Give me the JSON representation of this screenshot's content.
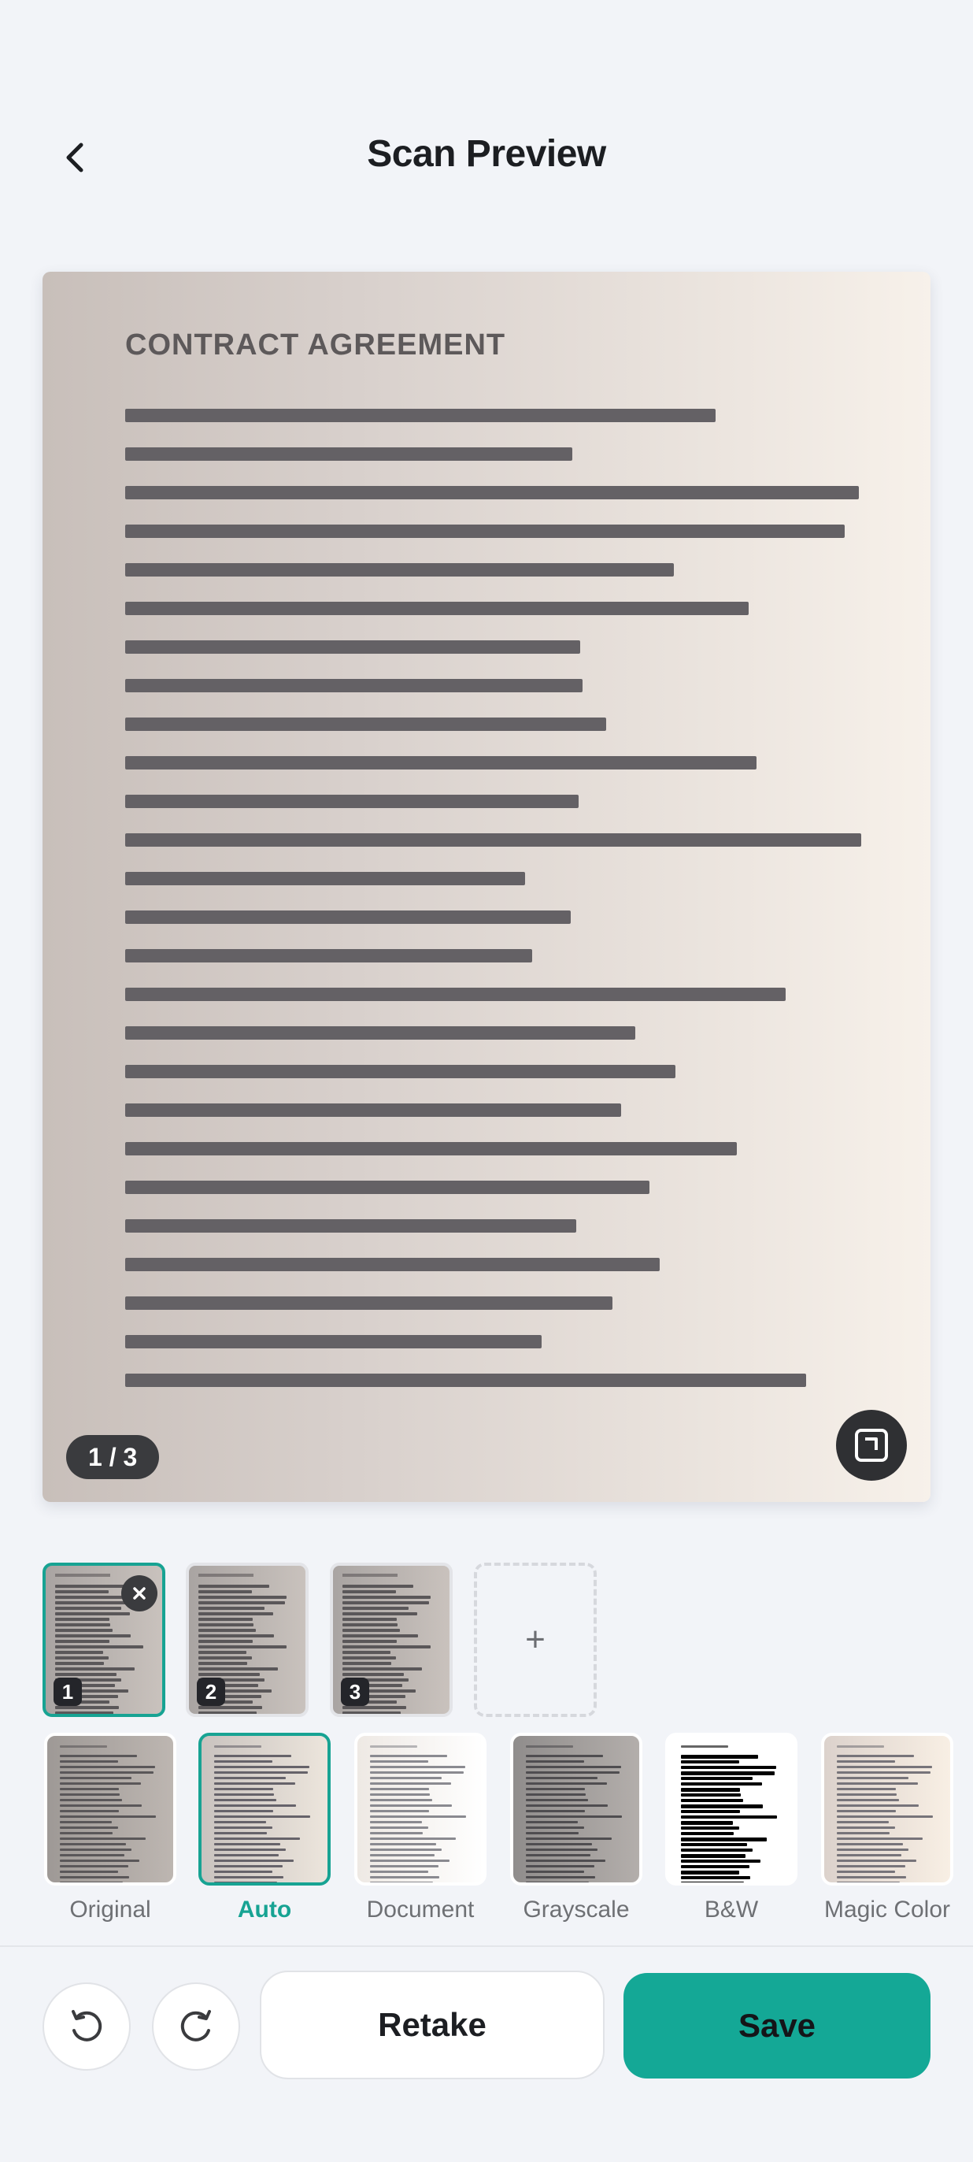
{
  "header": {
    "title": "Scan Preview",
    "back_icon": "chevron-left-icon"
  },
  "preview": {
    "document_title": "CONTRACT AGREEMENT",
    "page_indicator": "1 / 3",
    "crop_icon": "crop-frame-icon"
  },
  "pages": [
    {
      "number": "1",
      "selected": true,
      "removable": true
    },
    {
      "number": "2",
      "selected": false
    },
    {
      "number": "3",
      "selected": false
    }
  ],
  "add_page": {
    "label": "+"
  },
  "filters": [
    {
      "label": "Original",
      "selected": false
    },
    {
      "label": "Auto",
      "selected": true
    },
    {
      "label": "Document",
      "selected": false
    },
    {
      "label": "Grayscale",
      "selected": false
    },
    {
      "label": "B&W",
      "selected": false
    },
    {
      "label": "Magic Color",
      "selected": false
    }
  ],
  "actions": {
    "undo_icon": "rotate-left-icon",
    "redo_icon": "rotate-right-icon",
    "retake_label": "Retake",
    "save_label": "Save"
  },
  "colors": {
    "accent": "#17a393",
    "save_button": "#14a896",
    "badge": "#3a3b3e"
  }
}
